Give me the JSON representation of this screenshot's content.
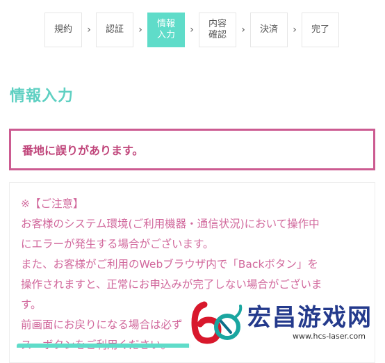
{
  "stepper": {
    "steps": [
      {
        "label": "規約"
      },
      {
        "label": "認証"
      },
      {
        "label": "情報\n入力"
      },
      {
        "label": "内容\n確認"
      },
      {
        "label": "決済"
      },
      {
        "label": "完了"
      }
    ],
    "arrow": "›",
    "active_index": 2,
    "active_color": "#5fdcc9"
  },
  "page": {
    "title": "情報入力",
    "title_color": "#5fd0c2"
  },
  "error": {
    "message": "番地に誤りがあります。",
    "border_color": "#cc5b91"
  },
  "notice": {
    "lines": [
      "※【ご注意】",
      "お客様のシステム環境(ご利用機器・通信状況)において操作中",
      "にエラーが発生する場合がございます。",
      "また、お客様がご利用のWebブラウザ内で「Backボタン」を",
      "操作されますと、正常にお申込みが完了しない場合がございま",
      "す。",
      "前画面にお戻りになる場合は必ず",
      "ス一ボタンをご利用ください。"
    ],
    "text_color": "#d1689c"
  },
  "watermark": {
    "name": "宏昌游戏网",
    "url": "www.hcs-laser.com"
  }
}
